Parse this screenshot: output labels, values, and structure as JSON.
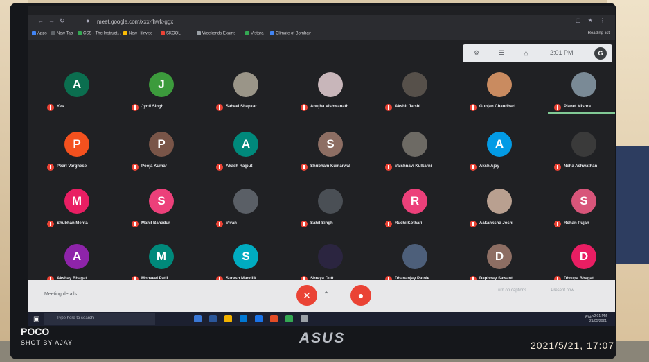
{
  "browser": {
    "url": "meet.google.com/xxx-fhwk-ggx",
    "bookmarks": [
      {
        "label": "Apps",
        "color": "#4285f4"
      },
      {
        "label": "New Tab",
        "color": "#5f6368"
      },
      {
        "label": "CSS - The Instruct...",
        "color": "#34a853"
      },
      {
        "label": "New Hikwise",
        "color": "#fbbc04"
      },
      {
        "label": "SKOOL",
        "color": "#ea4335"
      },
      {
        "label": "Weekends Exams",
        "color": "#9aa0a6"
      },
      {
        "label": "Vistara",
        "color": "#34a853"
      },
      {
        "label": "Climate of Bombay",
        "color": "#4285f4"
      }
    ],
    "reading_list": "Reading list"
  },
  "meet_panel": {
    "time": "2:01 PM",
    "avatar_letter": "G"
  },
  "participants": [
    {
      "name": "Yes",
      "initial": "A",
      "color": "#0b6e4f"
    },
    {
      "name": "Jyoti Singh",
      "initial": "J",
      "color": "#3c9b3c"
    },
    {
      "name": "Saheel Shapkar",
      "initial": "",
      "color": "#9a9588",
      "photo": true
    },
    {
      "name": "Anujha Vishwanath",
      "initial": "",
      "color": "#c8b6ba",
      "photo": true
    },
    {
      "name": "Akshit Jaishi",
      "initial": "",
      "color": "#56504a",
      "photo": true
    },
    {
      "name": "Gunjan Chaudhari",
      "initial": "",
      "color": "#c98b60",
      "photo": true
    },
    {
      "name": "Planet Mishra",
      "initial": "",
      "color": "#7a8a96",
      "photo": true,
      "pinned": true
    },
    {
      "name": "Pearl Varghese",
      "initial": "P",
      "color": "#f4511e"
    },
    {
      "name": "Pooja Kumar",
      "initial": "P",
      "color": "#795548"
    },
    {
      "name": "Akash Rajput",
      "initial": "A",
      "color": "#00897b"
    },
    {
      "name": "Shubham Kumarwal",
      "initial": "S",
      "color": "#8d6e63"
    },
    {
      "name": "Vaishnavi Kulkarni",
      "initial": "",
      "color": "#6d6a64",
      "photo": true
    },
    {
      "name": "Aksh Ajay",
      "initial": "A",
      "color": "#039be5"
    },
    {
      "name": "Neha Ashwathan",
      "initial": "",
      "color": "#3a3a3a",
      "photo": true
    },
    {
      "name": "Shubhan Mehta",
      "initial": "M",
      "color": "#e91e63"
    },
    {
      "name": "Mahil Bahadur",
      "initial": "S",
      "color": "#ec407a"
    },
    {
      "name": "Vivan",
      "initial": "",
      "color": "#5a5f66",
      "photo": true
    },
    {
      "name": "Sahil Singh",
      "initial": "",
      "color": "#4a4f55",
      "photo": true
    },
    {
      "name": "Ruchi Kothari",
      "initial": "R",
      "color": "#ec407a"
    },
    {
      "name": "Aakanksha Joshi",
      "initial": "",
      "color": "#b9a090",
      "photo": true
    },
    {
      "name": "Rohan Pujan",
      "initial": "S",
      "color": "#d8557a"
    },
    {
      "name": "Akshay Bhagat",
      "initial": "A",
      "color": "#8e24aa"
    },
    {
      "name": "Monaeel Patil",
      "initial": "M",
      "color": "#00897b"
    },
    {
      "name": "Suresh Mandlik",
      "initial": "S",
      "color": "#00acc1"
    },
    {
      "name": "Shreya Dutt",
      "initial": "",
      "color": "#2b2540",
      "photo": true
    },
    {
      "name": "Dhananjay Patole",
      "initial": "",
      "color": "#4d5f7a",
      "photo": true
    },
    {
      "name": "Daphnay Sawant",
      "initial": "D",
      "color": "#8d6e63"
    },
    {
      "name": "Dhrupa Bhagat",
      "initial": "D",
      "color": "#e91e63"
    }
  ],
  "meet_bar": {
    "details": "Meeting details",
    "hangup_icon": "call-end-icon",
    "mic_icon": "mic-off-icon",
    "cam_icon": "videocam-off-icon",
    "actions": [
      "Turn on captions",
      "Present now"
    ]
  },
  "taskbar": {
    "search_placeholder": "Type here to search",
    "tray": "ENG",
    "clock_time": "2:01 PM",
    "clock_date": "21/05/2021"
  },
  "bezel": {
    "brand": "ASUS"
  },
  "watermark": {
    "brand": "POCO",
    "shot_by": "SHOT BY AJAY",
    "timestamp": "2021/5/21, 17:07"
  }
}
